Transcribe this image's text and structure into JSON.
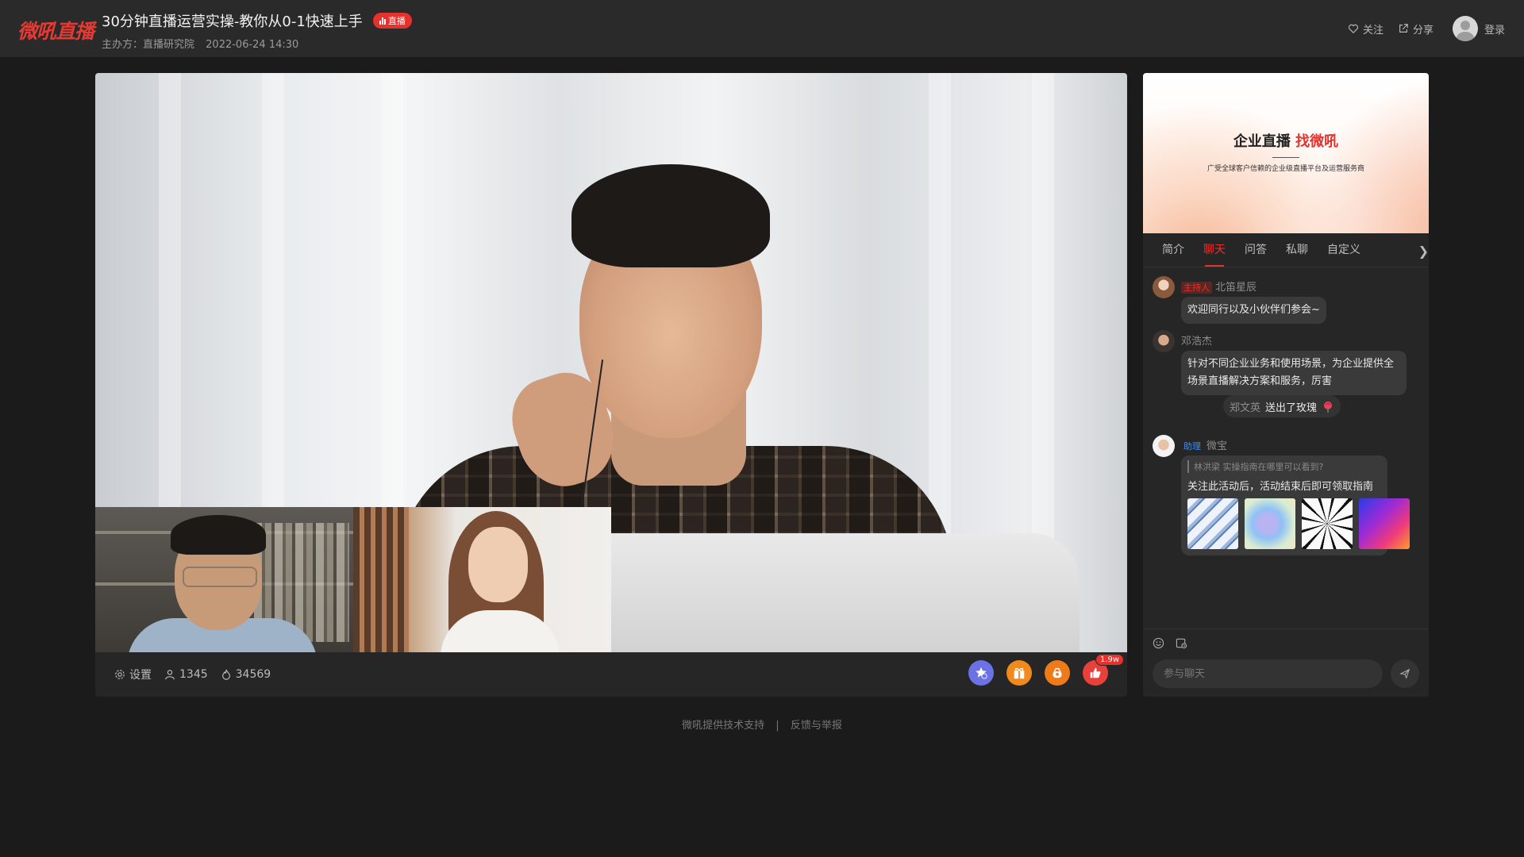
{
  "header": {
    "logo_text": "微吼直播",
    "title": "30分钟直播运营实操-教你从0-1快速上手",
    "live_badge": "直播",
    "organizer": "主办方：直播研究院",
    "datetime": "2022-06-24 14:30",
    "follow_label": "关注",
    "share_label": "分享",
    "login_label": "登录"
  },
  "video": {
    "settings_label": "设置",
    "viewers": "1345",
    "heat": "34569",
    "like_count": "1.9w"
  },
  "panel": {
    "banner": {
      "title_part1": "企业直播",
      "title_part2": "找微吼",
      "subtitle": "广受全球客户信赖的企业级直播平台及运营服务商"
    },
    "tabs": [
      "简介",
      "聊天",
      "问答",
      "私聊",
      "自定义"
    ],
    "active_tab": "聊天",
    "messages": [
      {
        "role": "主持人",
        "name": "北笛星辰",
        "text": "欢迎同行以及小伙伴们参会~"
      },
      {
        "name": "邓浩杰",
        "text_line1": "针对不同企业业务和使用场景，为企业提供全",
        "text_line2": "场景直播解决方案和服务，厉害"
      },
      {
        "gift_sender": "郑文英",
        "gift_text": "送出了玫瑰"
      },
      {
        "role": "助理",
        "name": "微宝",
        "quote": "林洪梁 实操指南在哪里可以看到?",
        "text": "关注此活动后，活动结束后即可领取指南"
      }
    ],
    "chat_placeholder": "参与聊天"
  },
  "footer": {
    "support": "微吼提供技术支持",
    "separator": "|",
    "report": "反馈与举报"
  },
  "colors": {
    "accent": "#e5322d",
    "background": "#1b1b1b",
    "panel": "#262626"
  }
}
